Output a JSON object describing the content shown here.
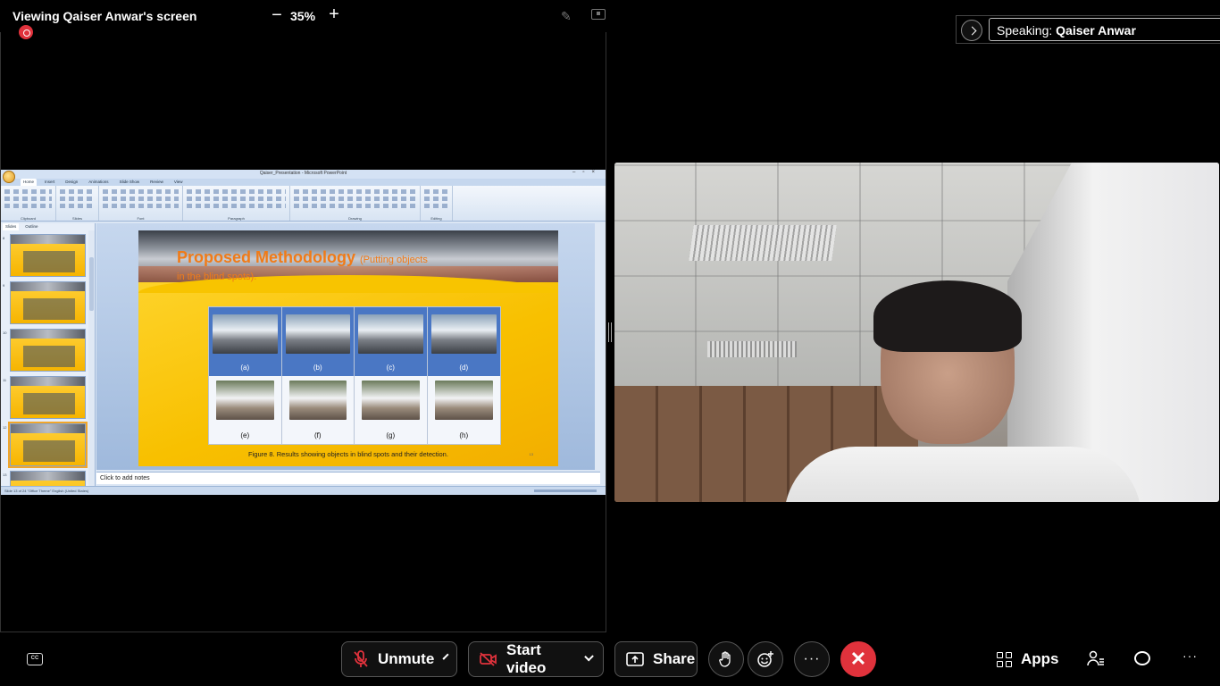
{
  "header": {
    "viewing_title": "Viewing Qaiser Anwar's screen",
    "zoom_minus": "−",
    "zoom_value": "35%",
    "zoom_plus": "+"
  },
  "ppt": {
    "window_title": "Qaiser_Presentation - Microsoft PowerPoint",
    "tabs": [
      "Home",
      "Insert",
      "Design",
      "Animations",
      "Slide Show",
      "Review",
      "View"
    ],
    "ribbon_groups": [
      "Clipboard",
      "Slides",
      "Font",
      "Paragraph",
      "Drawing",
      "Editing"
    ],
    "panel_tabs": [
      "Slides",
      "Outline"
    ],
    "thumb_numbers": [
      "8",
      "9",
      "10",
      "11",
      "12",
      "13"
    ],
    "slide": {
      "title": "Proposed Methodology",
      "title_suffix": "(Putting objects",
      "title_line2": "in the blind spots).",
      "labels": [
        "(a)",
        "(b)",
        "(c)",
        "(d)",
        "(e)",
        "(f)",
        "(g)",
        "(h)"
      ],
      "caption": "Figure 8. Results showing objects in blind spots and their detection.",
      "number": "13"
    },
    "notes_placeholder": "Click to add notes",
    "status_text": "Slide 13 of 24   \"Office Theme\"   English (United States)"
  },
  "speaking": {
    "label": "Speaking:",
    "name": "Qaiser Anwar"
  },
  "toolbar": {
    "unmute": "Unmute",
    "start_video": "Start video",
    "share": "Share",
    "apps": "Apps"
  },
  "colors": {
    "leave_red": "#e0323c",
    "slide_yellow": "#f8c000",
    "slide_title_orange": "#f07b18"
  },
  "icons": {
    "captions": "cc-icon",
    "microphone_muted": "mic-off-icon",
    "camera_off": "video-off-icon",
    "share": "share-icon",
    "raise_hand": "hand-icon",
    "reactions": "emoji-icon",
    "more": "more-icon",
    "leave": "close-icon",
    "apps": "apps-icon",
    "participants": "participants-icon",
    "chat": "chat-icon"
  }
}
